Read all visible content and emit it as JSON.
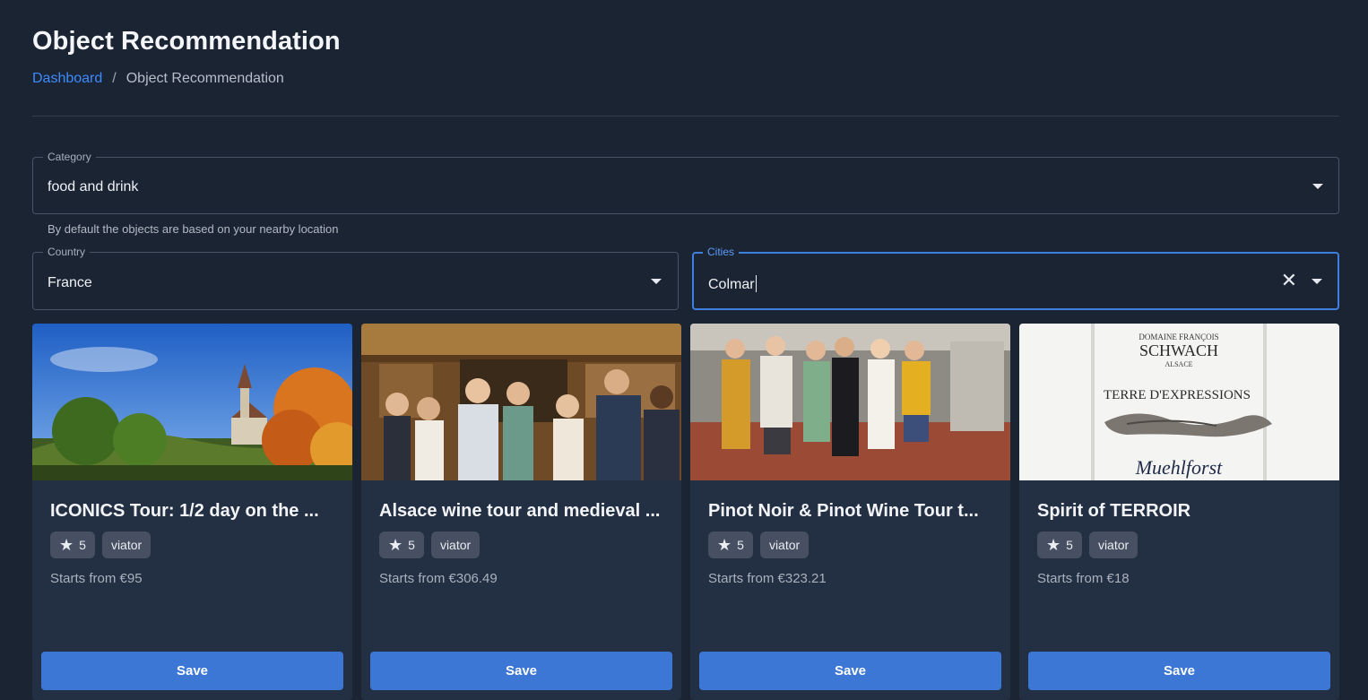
{
  "page": {
    "title": "Object Recommendation"
  },
  "breadcrumb": {
    "link": "Dashboard",
    "separator": "/",
    "current": "Object Recommendation"
  },
  "filters": {
    "category": {
      "label": "Category",
      "value": "food and drink"
    },
    "helper_text": "By default the objects are based on your nearby location",
    "country": {
      "label": "Country",
      "value": "France"
    },
    "cities": {
      "label": "Cities",
      "value": "Colmar"
    }
  },
  "colors": {
    "background": "#1b2433",
    "card": "#232f43",
    "accent": "#3c77d5",
    "link": "#3d8bff"
  },
  "cards": [
    {
      "title": "ICONICS Tour: 1/2 day on the ...",
      "rating": "5",
      "source": "viator",
      "price": "Starts from €95",
      "save_label": "Save",
      "image_name": "vineyard-village-photo"
    },
    {
      "title": "Alsace wine tour and medieval ...",
      "rating": "5",
      "source": "viator",
      "price": "Starts from €306.49",
      "save_label": "Save",
      "image_name": "wine-tasting-group-photo"
    },
    {
      "title": "Pinot Noir & Pinot Wine Tour t...",
      "rating": "5",
      "source": "viator",
      "price": "Starts from €323.21",
      "save_label": "Save",
      "image_name": "winery-cellar-group-photo"
    },
    {
      "title": "Spirit of TERROIR",
      "rating": "5",
      "source": "viator",
      "price": "Starts from €18",
      "save_label": "Save",
      "image_name": "wine-label-photo",
      "label_text": {
        "top": "DOMAINE FRANÇOIS",
        "brand": "SCHWACH",
        "region": "ALSACE",
        "name": "TERRE D'EXPRESSIONS",
        "script": "Muehlforst"
      }
    }
  ]
}
